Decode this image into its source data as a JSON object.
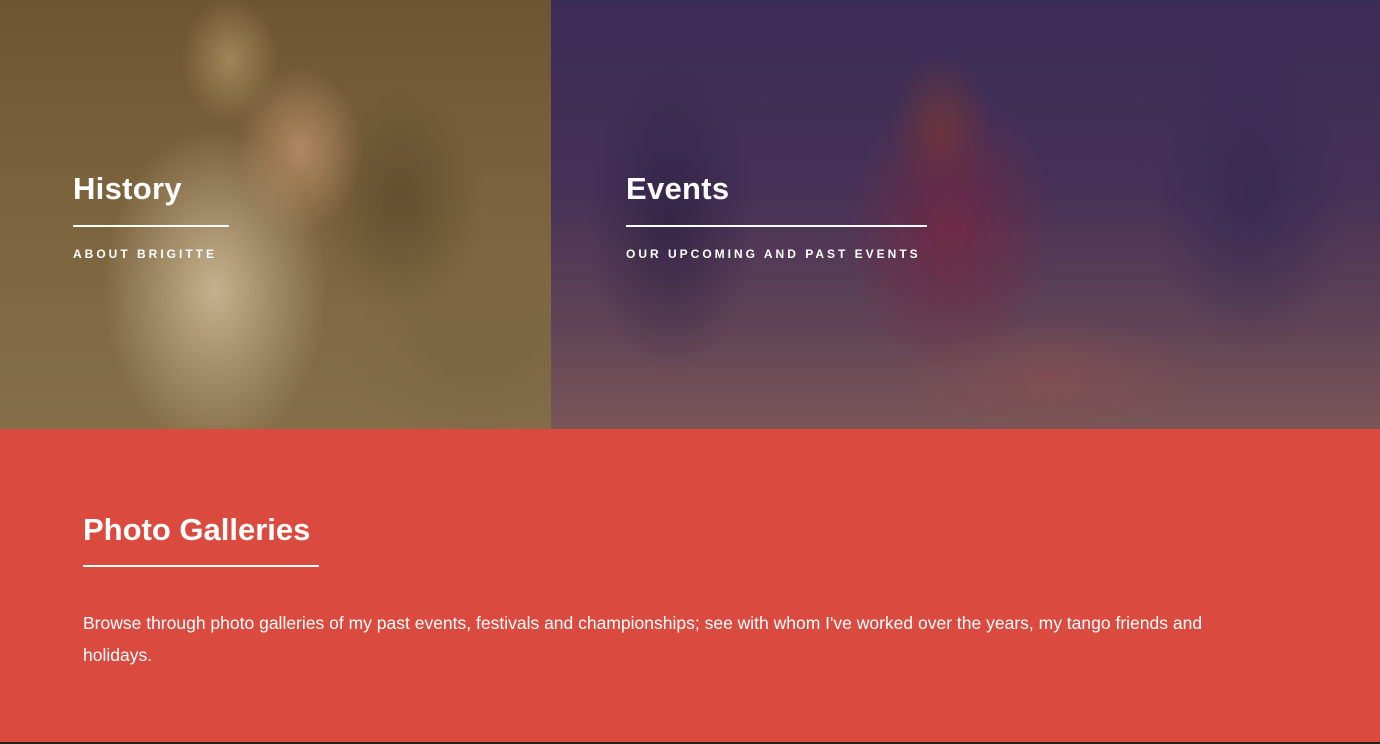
{
  "tiles": [
    {
      "title": "History",
      "subtitle": "ABOUT BRIGITTE"
    },
    {
      "title": "Events",
      "subtitle": "OUR UPCOMING AND PAST EVENTS"
    }
  ],
  "gallery": {
    "title": "Photo Galleries",
    "description": "Browse through photo galleries of my past events, festivals and championships; see with whom I've worked over the years, my tango friends and holidays."
  },
  "colors": {
    "accent_red": "#da4a3e",
    "text": "#ffffff"
  }
}
